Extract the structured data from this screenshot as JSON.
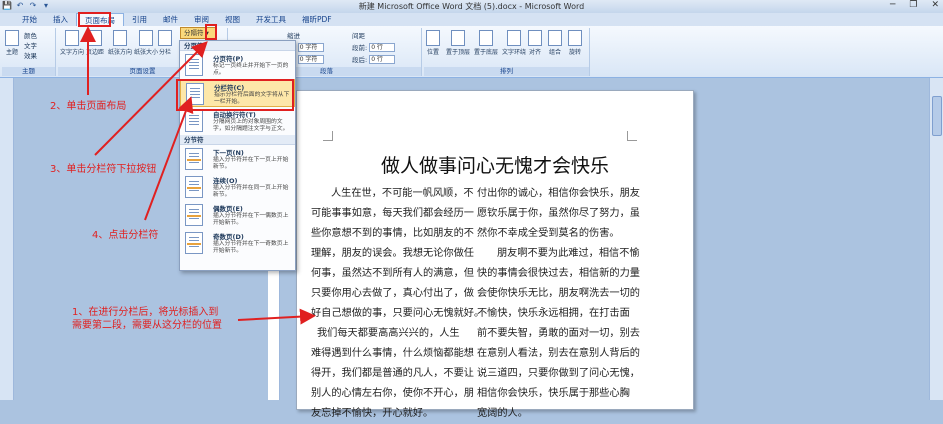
{
  "window": {
    "title": "新建 Microsoft Office Word 文档 (5).docx - Microsoft Word",
    "minimize": "─",
    "restore": "❐",
    "close": "✕"
  },
  "quick_access": [
    "💾",
    "↶",
    "↷",
    "▾"
  ],
  "tabs": [
    "开始",
    "插入",
    "页面布局",
    "引用",
    "邮件",
    "审阅",
    "视图",
    "开发工具",
    "福昕PDF"
  ],
  "active_tab": "页面布局",
  "ribbon": {
    "themes": {
      "label": "主题",
      "items": [
        "颜色",
        "文字",
        "效果"
      ],
      "button": "主题"
    },
    "page_setup": {
      "label": "页面设置",
      "buttons": [
        "文字方向",
        "页边距",
        "纸张方向",
        "纸张大小",
        "分栏"
      ],
      "breaks_button": "分隔符",
      "line_numbers": "行号",
      "hyphenation": "断字"
    },
    "paragraph": {
      "label": "段落",
      "indent": "缩进",
      "spacing": "间距",
      "left_label": "左:",
      "right_label": "右:",
      "before_label": "段前:",
      "after_label": "段后:",
      "left_value": "0 字符",
      "right_value": "0 字符",
      "before_value": "0 行",
      "after_value": "0 行"
    },
    "arrange": {
      "label": "排列",
      "buttons": [
        "位置",
        "置于顶层",
        "置于底层",
        "文字环绕",
        "对齐",
        "组合",
        "旋转"
      ]
    }
  },
  "breaks_menu": {
    "page_breaks_header": "分页符",
    "section_breaks_header": "分节符",
    "items": [
      {
        "title": "分页符(P)",
        "desc": [
          "标记一页终止并开始下一页的",
          "点。"
        ]
      },
      {
        "title": "分栏符(C)",
        "desc": [
          "指示分栏符后面的文字将从下",
          "一栏开始。"
        ]
      },
      {
        "title": "自动换行符(T)",
        "desc": [
          "分隔网页上的对象周围的文",
          "字，如分隔题注文字与正文。"
        ]
      },
      {
        "title": "下一页(N)",
        "desc": [
          "插入分节符并在下一页上开始",
          "新节。"
        ]
      },
      {
        "title": "连续(O)",
        "desc": [
          "插入分节符并在同一页上开始",
          "新节。"
        ]
      },
      {
        "title": "偶数页(E)",
        "desc": [
          "插入分节符并在下一偶数页上",
          "开始新节。"
        ]
      },
      {
        "title": "奇数页(D)",
        "desc": [
          "插入分节符并在下一奇数页上",
          "开始新节。"
        ]
      }
    ]
  },
  "document": {
    "title": "做人做事问心无愧才会快乐",
    "left_column": [
      "人生在世，不可能一帆风顺，不",
      "可能事事如意，每天我们都会经历一",
      "些你意想不到的事情，比如朋友的不",
      "理解，朋友的误会。我想无论你做任",
      "何事，虽然达不到所有人的满意，但",
      "只要你用心去做了，真心付出了，做",
      "好自己想做的事，只要问心无愧就好。",
      "我们每天都要高高兴兴的，人生",
      "难得遇到什么事情，什么烦恼都能想",
      "得开，我们都是普通的凡人，不要让",
      "别人的心情左右你，使你不开心，朋",
      "友忘掉不愉快，开心就好。"
    ],
    "right_column": [
      "付出你的诚心，相信你会快乐，朋友",
      "愿钦乐属于你，虽然你尽了努力，虽",
      "然你不幸成全受到莫名的伤害。",
      "朋友啊不要为此难过，相信不愉",
      "快的事情会很快过去，相信新的力量",
      "会使你快乐无比，朋友啊洗去一切的",
      "不愉快，快乐永远相拥，在打击面",
      "前不要失智，勇敢的面对一切，别去",
      "在意别人看法，别去在意别人背后的",
      "说三道四，只要你做到了问心无愧，",
      "相信你会快乐，快乐属于那些心胸",
      "宽阔的人。"
    ]
  },
  "annotations": {
    "step1": [
      "1、在进行分栏后，将光标插入到",
      "需要第二段，需要从这分栏的位置"
    ],
    "step2": "2、单击页面布局",
    "step3": "3、单击分栏符下拉按钮",
    "step4": "4、点击分栏符",
    "color": "#e02020"
  }
}
